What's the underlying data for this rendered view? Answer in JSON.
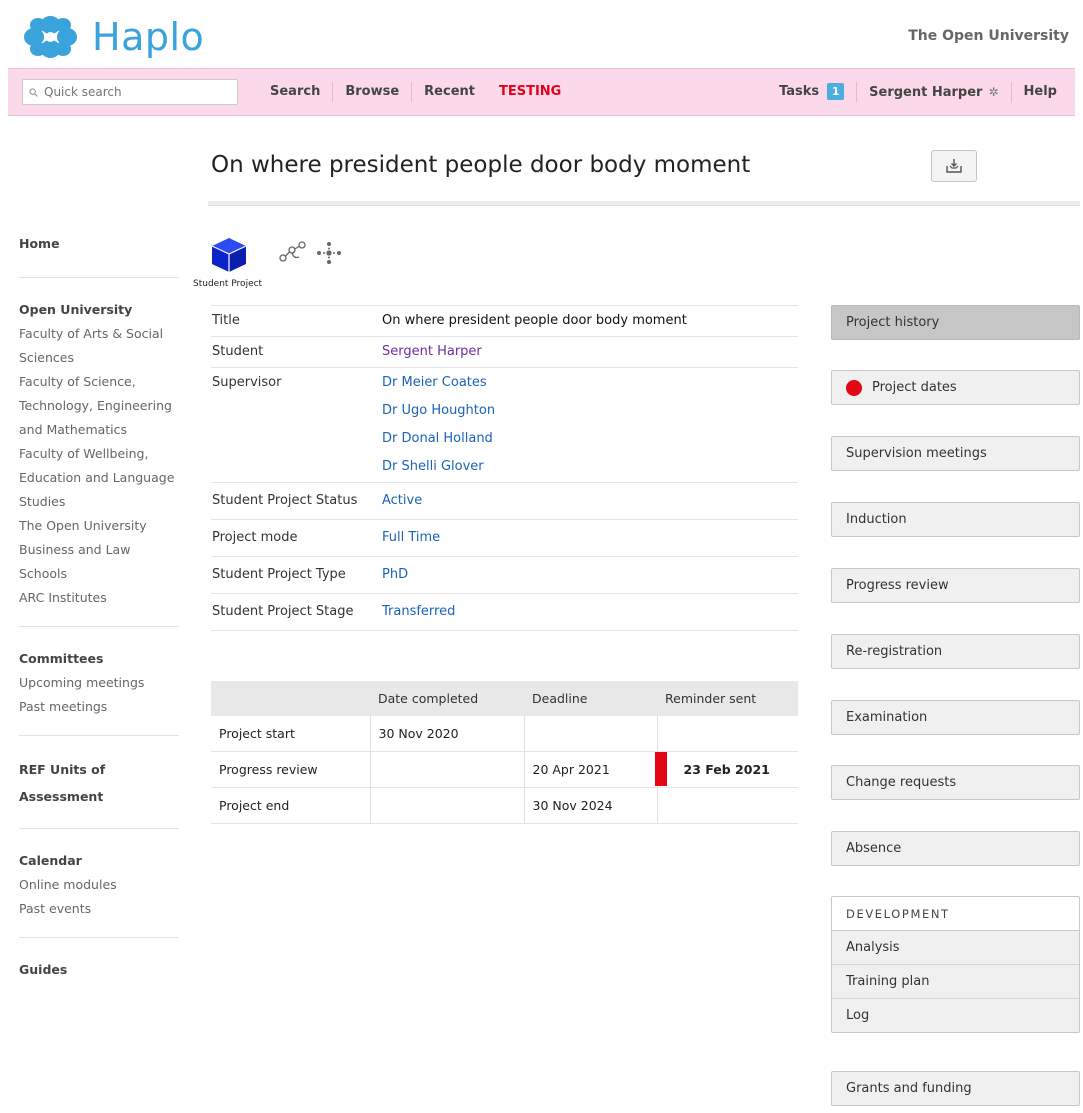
{
  "app": {
    "name": "Haplo",
    "organization": "The Open University"
  },
  "navbar": {
    "search_placeholder": "Quick search",
    "left_items": [
      "Search",
      "Browse",
      "Recent",
      "TESTING"
    ],
    "tasks_label": "Tasks",
    "tasks_count": "1",
    "user_name": "Sergent Harper",
    "help_label": "Help"
  },
  "page": {
    "title": "On where president people door body moment"
  },
  "sidebar": {
    "home": "Home",
    "org_heading": "Open University",
    "org_links": [
      "Faculty of Arts & Social Sciences",
      "Faculty of Science, Technology, Engineering and Mathematics",
      "Faculty of Wellbeing, Education and Language Studies",
      "The Open University Business and Law Schools",
      "ARC Institutes"
    ],
    "committees_heading": "Committees",
    "committees_links": [
      "Upcoming meetings",
      "Past meetings"
    ],
    "ref_heading": "REF Units of Assessment",
    "calendar_heading": "Calendar",
    "calendar_links": [
      "Online modules",
      "Past events"
    ],
    "guides": "Guides"
  },
  "record_type": {
    "label": "Student Project",
    "icon": "cube-icon",
    "color": "#0b2bd4"
  },
  "attributes": {
    "title": {
      "label": "Title",
      "value": "On where president people door body moment"
    },
    "student": {
      "label": "Student",
      "value": "Sergent Harper"
    },
    "supervisor": {
      "label": "Supervisor",
      "values": [
        "Dr Meier Coates",
        "Dr Ugo Houghton",
        "Dr Donal Holland",
        "Dr Shelli Glover"
      ]
    },
    "status": {
      "label": "Student Project Status",
      "value": "Active"
    },
    "mode": {
      "label": "Project mode",
      "value": "Full Time"
    },
    "type": {
      "label": "Student Project Type",
      "value": "PhD"
    },
    "stage": {
      "label": "Student Project Stage",
      "value": "Transferred"
    }
  },
  "dates_table": {
    "headers": [
      "",
      "Date completed",
      "Deadline",
      "Reminder sent"
    ],
    "rows": [
      {
        "name": "Project start",
        "completed": "30 Nov 2020",
        "deadline": "",
        "reminder": ""
      },
      {
        "name": "Progress review",
        "completed": "",
        "deadline": "20 Apr 2021",
        "reminder": "23 Feb 2021"
      },
      {
        "name": "Project end",
        "completed": "",
        "deadline": "30 Nov 2024",
        "reminder": ""
      }
    ]
  },
  "actions": {
    "project_history": "Project history",
    "project_dates": "Project dates",
    "supervision_meetings": "Supervision meetings",
    "induction": "Induction",
    "progress_review": "Progress review",
    "re_registration": "Re-registration",
    "examination": "Examination",
    "change_requests": "Change requests",
    "absence": "Absence",
    "development_heading": "DEVELOPMENT",
    "development_items": [
      "Analysis",
      "Training plan",
      "Log"
    ],
    "grants_and_funding": "Grants and funding"
  },
  "colors": {
    "accent": "#3aa3dc",
    "navbar": "#fcd9ea",
    "testing": "#e3001b",
    "alert": "#e30613",
    "link": "#1a63b8"
  }
}
